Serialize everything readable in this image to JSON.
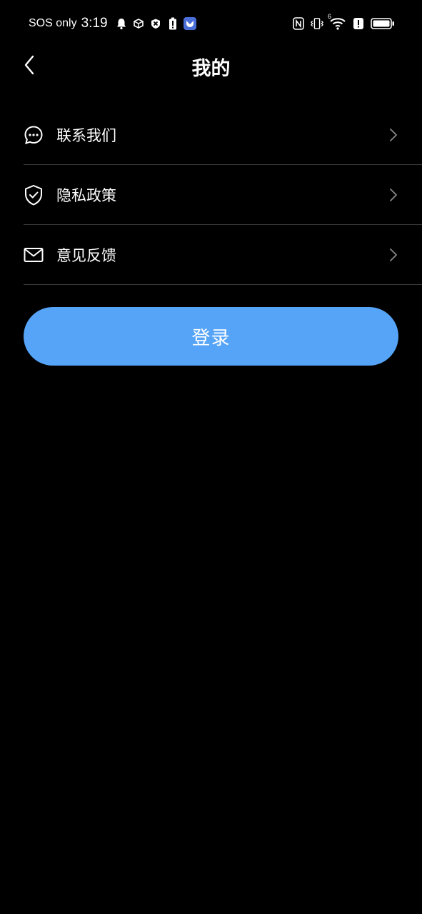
{
  "status_bar": {
    "carrier": "SOS only",
    "time": "3:19",
    "icons_left": [
      "bell-icon",
      "box-icon",
      "block-icon",
      "battery-alert-icon",
      "app-badge-icon"
    ],
    "icons_right": [
      "nfc-icon",
      "vibrate-icon",
      "wifi-icon",
      "alert-icon",
      "battery-icon"
    ],
    "wifi_label": "6"
  },
  "header": {
    "title": "我的",
    "back_icon": "chevron-left-icon"
  },
  "menu": {
    "items": [
      {
        "label": "联系我们",
        "icon": "chat-bubble-icon"
      },
      {
        "label": "隐私政策",
        "icon": "shield-check-icon"
      },
      {
        "label": "意见反馈",
        "icon": "mail-icon"
      }
    ]
  },
  "login": {
    "label": "登录",
    "color": "#56a4f7"
  },
  "colors": {
    "background": "#000000",
    "text": "#ffffff",
    "divider": "#3a3a3a",
    "chevron": "#8a8a8a",
    "accent": "#56a4f7"
  }
}
